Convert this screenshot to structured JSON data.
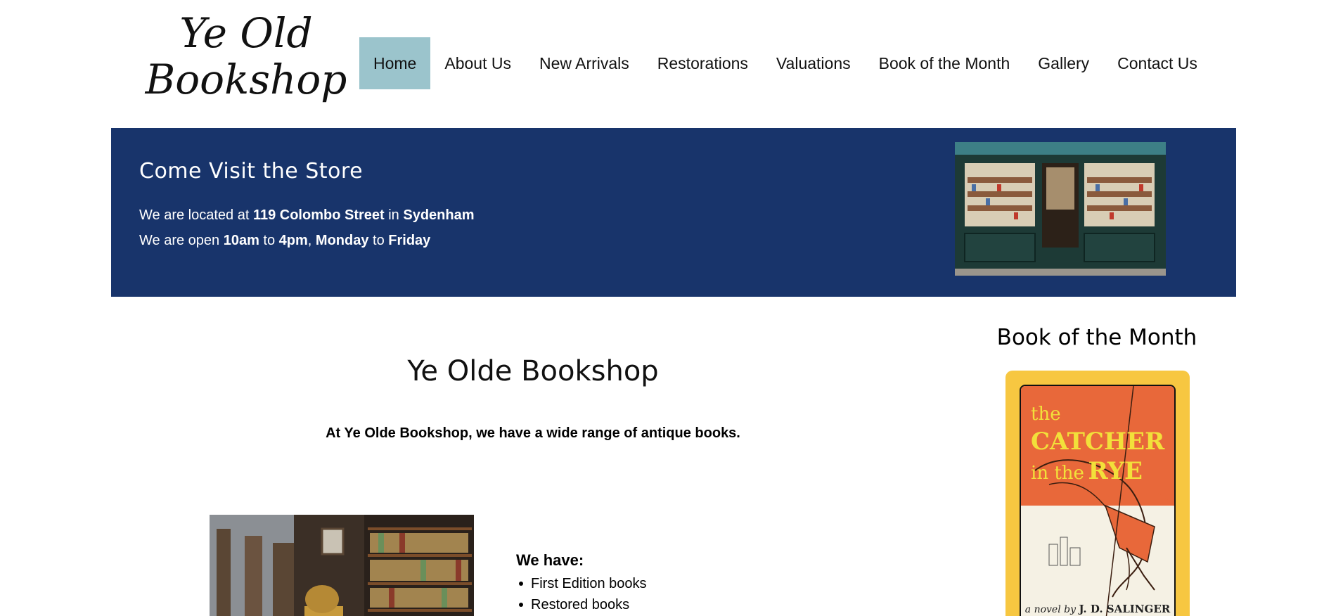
{
  "header": {
    "logo_line1": "Ye Old",
    "logo_line2": "Bookshop",
    "nav": [
      {
        "label": "Home",
        "active": true
      },
      {
        "label": "About Us"
      },
      {
        "label": "New Arrivals"
      },
      {
        "label": "Restorations"
      },
      {
        "label": "Valuations"
      },
      {
        "label": "Book of the Month"
      },
      {
        "label": "Gallery"
      },
      {
        "label": "Contact Us"
      }
    ]
  },
  "banner": {
    "title": "Come Visit the Store",
    "line1": {
      "prefix": "We are located at ",
      "street": "119 Colombo Street",
      "mid": " in ",
      "suburb": "Sydenham"
    },
    "line2": {
      "prefix": "We are open ",
      "open": "10am",
      "to1": " to ",
      "close": "4pm",
      "comma": ", ",
      "day_from": "Monday",
      "to2": " to ",
      "day_to": "Friday"
    },
    "image_alt": "Bookshop storefront"
  },
  "main": {
    "title": "Ye Olde Bookshop",
    "intro": "At Ye Olde Bookshop, we have a wide range of antique books.",
    "we_have_label": "We have:",
    "features": [
      "First Edition books",
      "Restored books"
    ]
  },
  "sidebar": {
    "title": "Book of the Month",
    "book": {
      "title_the": "the",
      "title_catcher": "CATCHER",
      "title_in_the": "in the",
      "title_rye": "RYE",
      "author_prefix": "a novel by",
      "author": "J. D. SALINGER"
    }
  },
  "colors": {
    "nav_active": "#9bc4cc",
    "banner_bg": "#18346b",
    "book_card_bg": "#f7c741",
    "cover_orange": "#e8683a"
  }
}
